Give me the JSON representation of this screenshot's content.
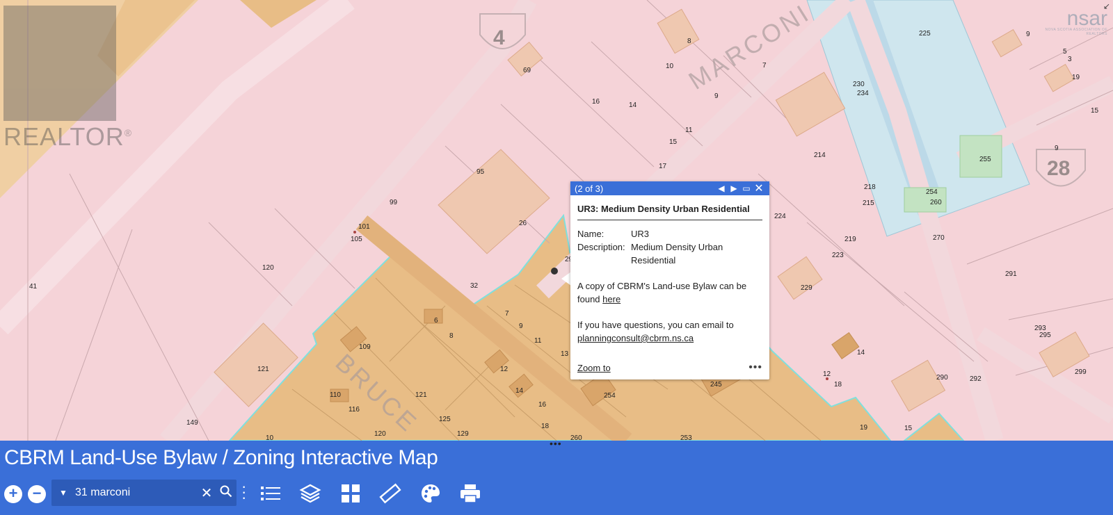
{
  "map": {
    "route_labels": [
      "4",
      "28"
    ],
    "street_labels": [
      "MARCONI",
      "BRUCE"
    ],
    "parcels": [
      {
        "label": "8"
      },
      {
        "label": "69"
      },
      {
        "label": "10"
      },
      {
        "label": "7"
      },
      {
        "label": "9"
      },
      {
        "label": "16"
      },
      {
        "label": "14"
      },
      {
        "label": "11"
      },
      {
        "label": "15"
      },
      {
        "label": "17"
      },
      {
        "label": "214"
      },
      {
        "label": "218"
      },
      {
        "label": "215"
      },
      {
        "label": "224"
      },
      {
        "label": "219"
      },
      {
        "label": "223"
      },
      {
        "label": "229"
      },
      {
        "label": "225"
      },
      {
        "label": "230"
      },
      {
        "label": "234"
      },
      {
        "label": "255"
      },
      {
        "label": "254"
      },
      {
        "label": "260"
      },
      {
        "label": "270"
      },
      {
        "label": "291"
      },
      {
        "label": "293"
      },
      {
        "label": "295"
      },
      {
        "label": "299"
      },
      {
        "label": "290"
      },
      {
        "label": "292"
      },
      {
        "label": "9"
      },
      {
        "label": "5"
      },
      {
        "label": "3"
      },
      {
        "label": "19"
      },
      {
        "label": "15"
      },
      {
        "label": "9"
      },
      {
        "label": "95"
      },
      {
        "label": "99"
      },
      {
        "label": "26"
      },
      {
        "label": "101"
      },
      {
        "label": "105"
      },
      {
        "label": "120"
      },
      {
        "label": "41"
      },
      {
        "label": "32"
      },
      {
        "label": "29"
      },
      {
        "label": "7"
      },
      {
        "label": "6"
      },
      {
        "label": "9"
      },
      {
        "label": "8"
      },
      {
        "label": "11"
      },
      {
        "label": "13"
      },
      {
        "label": "109"
      },
      {
        "label": "12"
      },
      {
        "label": "121"
      },
      {
        "label": "121"
      },
      {
        "label": "14"
      },
      {
        "label": "16"
      },
      {
        "label": "110"
      },
      {
        "label": "116"
      },
      {
        "label": "125"
      },
      {
        "label": "149"
      },
      {
        "label": "18"
      },
      {
        "label": "254"
      },
      {
        "label": "245"
      },
      {
        "label": "14"
      },
      {
        "label": "12"
      },
      {
        "label": "18"
      },
      {
        "label": "19"
      },
      {
        "label": "15"
      },
      {
        "label": "10"
      },
      {
        "label": "120"
      },
      {
        "label": "129"
      },
      {
        "label": "260"
      },
      {
        "label": "253"
      }
    ],
    "colors": {
      "residential": "#f5d3d8",
      "commercial": "#e8bd86",
      "institutional": "#cfe6ee",
      "zone_outline": "#7fe0dd"
    }
  },
  "watermarks": {
    "realtor": "REALTOR",
    "realtor_mark": "®",
    "nsar": "nsar",
    "nsar_sub": "NOVA SCOTIA ASSOCIATION OF REALTORS"
  },
  "popup": {
    "count": "(2 of 3)",
    "title": "UR3: Medium Density Urban Residential",
    "attributes": [
      {
        "key": "Name:",
        "value": "UR3"
      },
      {
        "key": "Description:",
        "value": "Medium Density Urban Residential"
      }
    ],
    "bylaw_text": "A copy of CBRM's Land-use Bylaw can be found",
    "bylaw_link": "here",
    "questions_text": "If you have questions, you can email to",
    "email": "planningconsult@cbrm.ns.ca",
    "zoom_to": "Zoom to"
  },
  "toolbar": {
    "title": "CBRM Land-Use Bylaw / Zoning Interactive Map",
    "zoom_in": "+",
    "zoom_out": "−",
    "search_value": "31 marconi",
    "tools": [
      "layer-list-icon",
      "layers-icon",
      "basemap-gallery-icon",
      "measure-icon",
      "palette-icon",
      "print-icon"
    ],
    "accent": "#3a6fd8"
  }
}
